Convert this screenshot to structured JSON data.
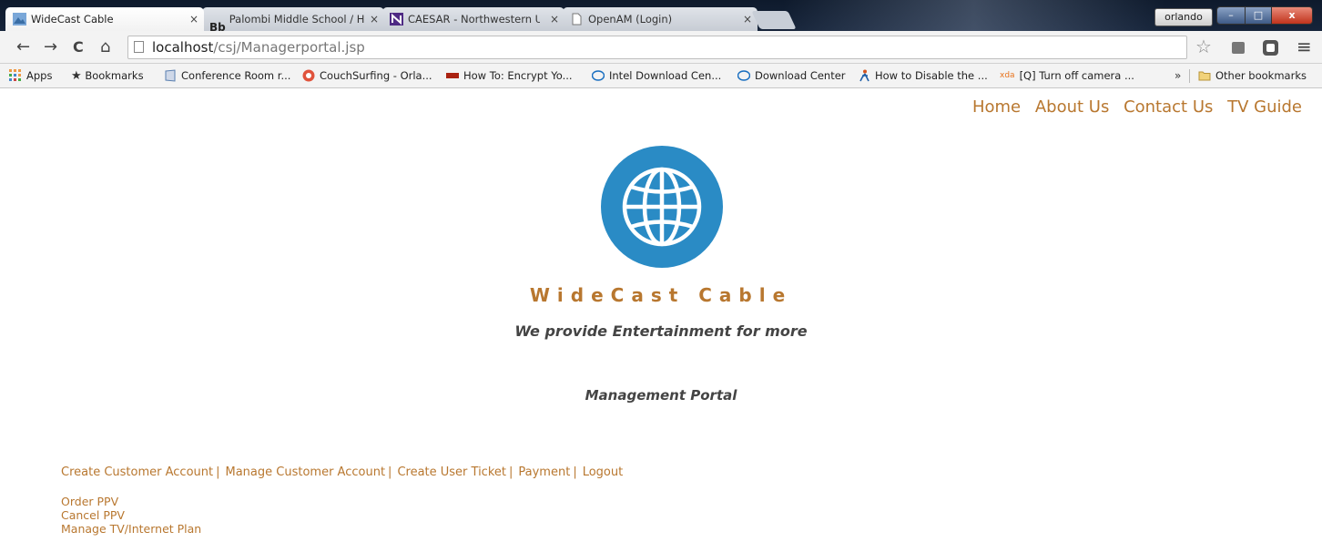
{
  "browser": {
    "tabs": [
      {
        "title": "WideCast Cable",
        "active": true
      },
      {
        "title": "Palombi Middle School / H",
        "prefix": "Bb",
        "active": false
      },
      {
        "title": "CAESAR - Northwestern U",
        "active": false
      },
      {
        "title": "OpenAM (Login)",
        "active": false
      }
    ],
    "tab_close_glyph": "×",
    "profile_name": "orlando",
    "window_controls": {
      "minimize": "–",
      "maximize": "□",
      "close": "x"
    },
    "nav": {
      "back": "←",
      "forward": "→",
      "reload": "C",
      "home": "⌂"
    },
    "url_host": "localhost",
    "url_path": "/csj/Managerportal.jsp",
    "bookmark_star": "☆",
    "menu_glyph": "≡",
    "bookmarks": [
      {
        "label": "Apps",
        "icon": "apps-grid-icon"
      },
      {
        "label": "Bookmarks",
        "icon": "star-icon"
      },
      {
        "label": "Conference Room r...",
        "icon": "calendar-icon"
      },
      {
        "label": "CouchSurfing - Orla...",
        "icon": "couchsurfing-icon"
      },
      {
        "label": "How To: Encrypt Yo...",
        "icon": "wpc-icon"
      },
      {
        "label": "Intel Download Cen...",
        "icon": "intel-icon"
      },
      {
        "label": "Download Center",
        "icon": "intel-icon"
      },
      {
        "label": "How to Disable the ...",
        "icon": "figure-icon"
      },
      {
        "label": "[Q] Turn off camera ...",
        "icon": "xda-icon"
      }
    ],
    "bookmarks_overflow": "»",
    "other_bookmarks": "Other bookmarks"
  },
  "page": {
    "top_nav": [
      "Home",
      "About Us",
      "Contact Us",
      "TV Guide"
    ],
    "brand_name": "WideCast Cable",
    "tagline": "We provide Entertainment for more",
    "section_title": "Management Portal",
    "menu_links": [
      "Create Customer Account",
      "Manage Customer Account",
      "Create User Ticket",
      "Payment",
      "Logout"
    ],
    "menu_separator": "|",
    "sub_links": [
      "Order PPV",
      "Cancel PPV",
      "Manage TV/Internet Plan"
    ]
  },
  "colors": {
    "accent": "#b8772f",
    "logo_blue": "#2a8bc5",
    "text_dark": "#444444"
  }
}
